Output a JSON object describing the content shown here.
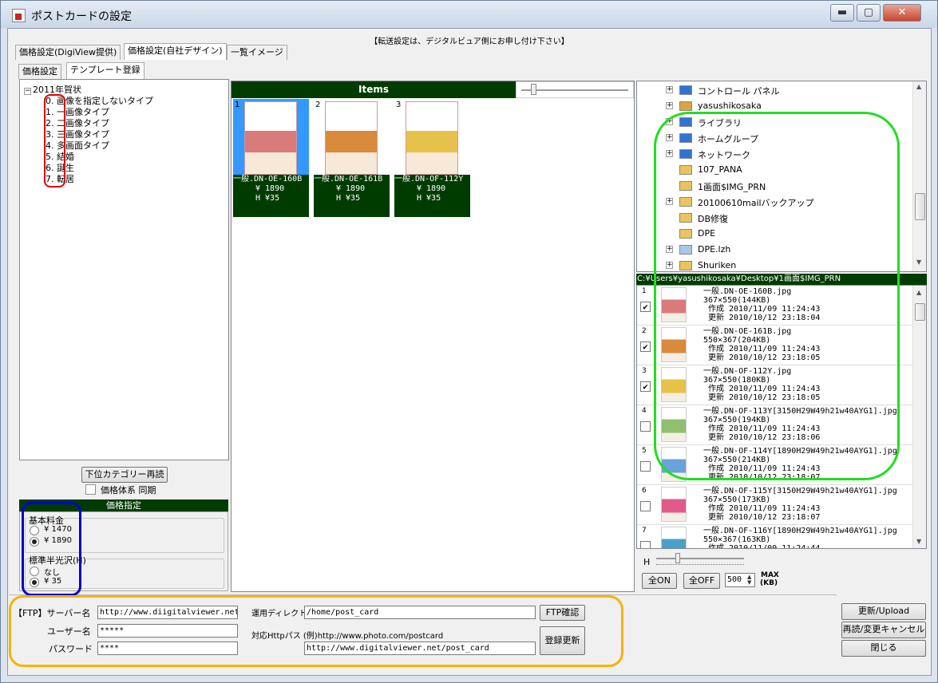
{
  "window": {
    "title": "ポストカードの設定",
    "minimize_glyph": "▬",
    "maximize_glyph": "▢",
    "close_glyph": "✕"
  },
  "notice": "【転送設定は、デジタルビュア側にお申し付け下さい】",
  "tabs": [
    {
      "label": "価格設定(DigiView提供)",
      "active": false
    },
    {
      "label": "価格設定(自社デザイン)",
      "active": true
    },
    {
      "label": "一覧イメージ",
      "active": false
    }
  ],
  "subtabs": [
    {
      "label": "価格設定",
      "active": false
    },
    {
      "label": "テンプレート登録",
      "active": true
    }
  ],
  "tree": {
    "root": "2011年賀状",
    "items": [
      {
        "num": "0.",
        "label": "画像を指定しないタイプ"
      },
      {
        "num": "1.",
        "label": "一画像タイプ"
      },
      {
        "num": "2.",
        "label": "二画像タイプ"
      },
      {
        "num": "3.",
        "label": "三画像タイプ"
      },
      {
        "num": "4.",
        "label": "多画面タイプ"
      },
      {
        "num": "5.",
        "label": "結婚"
      },
      {
        "num": "6.",
        "label": "誕生"
      },
      {
        "num": "7.",
        "label": "転居"
      }
    ]
  },
  "left_controls": {
    "reload_button": "下位カテゴリー再読",
    "sync_checkbox": "価格体系 同期",
    "price_header": "価格指定",
    "base_price_label": "基本料金",
    "base_options": [
      "¥ 1470",
      "¥ 1890"
    ],
    "base_selected": 1,
    "gloss_label": "標準半光沢(H)",
    "gloss_options": [
      "なし",
      "¥ 35"
    ],
    "gloss_selected": 1
  },
  "items_panel": {
    "header": "Items",
    "cards": [
      {
        "num": "1",
        "name": "一般.DN-OE-160B",
        "price": "¥ 1890",
        "extra": "H ¥35",
        "selected": true,
        "color": "#d97b7b"
      },
      {
        "num": "2",
        "name": "一般.DN-OE-161B",
        "price": "¥ 1890",
        "extra": "H ¥35",
        "selected": false,
        "color": "#d98a3a"
      },
      {
        "num": "3",
        "name": "一般.DN-OF-112Y",
        "price": "¥ 1890",
        "extra": "H ¥35",
        "selected": false,
        "color": "#e6c24a"
      }
    ]
  },
  "folders": [
    {
      "label": "コントロール パネル",
      "expander": true,
      "icon": "blue"
    },
    {
      "label": "yasushikosaka",
      "expander": true,
      "icon": "user"
    },
    {
      "label": "ライブラリ",
      "expander": true,
      "icon": "blue"
    },
    {
      "label": "ホームグループ",
      "expander": true,
      "icon": "blue"
    },
    {
      "label": "ネットワーク",
      "expander": true,
      "icon": "blue"
    },
    {
      "label": "107_PANA",
      "expander": false,
      "icon": "yellow"
    },
    {
      "label": "1画面$IMG_PRN",
      "expander": false,
      "icon": "yellow"
    },
    {
      "label": "20100610mailバックアップ",
      "expander": true,
      "icon": "yellow"
    },
    {
      "label": "DB修復",
      "expander": false,
      "icon": "yellow"
    },
    {
      "label": "DPE",
      "expander": false,
      "icon": "yellow"
    },
    {
      "label": "DPE.lzh",
      "expander": true,
      "icon": "zip"
    },
    {
      "label": "Shuriken",
      "expander": true,
      "icon": "yellow"
    }
  ],
  "path_bar": "C:¥Users¥yasushikosaka¥Desktop¥1画面$IMG_PRN",
  "files": [
    {
      "num": "1",
      "checked": true,
      "name": "一般.DN-OE-160B.jpg",
      "dims": "367×550(144KB)",
      "created": "作成 2010/11/09 11:24:43",
      "updated": "更新 2010/10/12 23:18:04",
      "color": "#d97b7b"
    },
    {
      "num": "2",
      "checked": true,
      "name": "一般.DN-OE-161B.jpg",
      "dims": "550×367(204KB)",
      "created": "作成 2010/11/09 11:24:43",
      "updated": "更新 2010/10/12 23:18:05",
      "color": "#d98a3a"
    },
    {
      "num": "3",
      "checked": true,
      "name": "一般.DN-OF-112Y.jpg",
      "dims": "367×550(180KB)",
      "created": "作成 2010/11/09 11:24:43",
      "updated": "更新 2010/10/12 23:18:05",
      "color": "#e6c24a"
    },
    {
      "num": "4",
      "checked": false,
      "name": "一般.DN-OF-113Y[3150H29W49h21w40AYG1].jpg",
      "dims": "367×550(194KB)",
      "created": "作成 2010/11/09 11:24:43",
      "updated": "更新 2010/10/12 23:18:06",
      "color": "#8fbf6f"
    },
    {
      "num": "5",
      "checked": false,
      "name": "一般.DN-OF-114Y[1890H29W49h21w40AYG1].jpg",
      "dims": "367×550(214KB)",
      "created": "作成 2010/11/09 11:24:43",
      "updated": "更新 2010/10/12 23:18:07",
      "color": "#6aa2d9"
    },
    {
      "num": "6",
      "checked": false,
      "name": "一般.DN-OF-115Y[3150H29W49h21w40AYG1].jpg",
      "dims": "367×550(173KB)",
      "created": "作成 2010/11/09 11:24:43",
      "updated": "更新 2010/10/12 23:18:07",
      "color": "#e05a8a"
    },
    {
      "num": "7",
      "checked": false,
      "name": "一般.DN-OF-116Y[1890H29W49h21w40AYG1].jpg",
      "dims": "550×367(163KB)",
      "created": "作成 2010/11/09 11:24:44",
      "updated": "",
      "color": "#4aa0c8"
    }
  ],
  "file_controls": {
    "h_label": "H",
    "all_on": "全ON",
    "all_off": "全OFF",
    "max_value": "500",
    "max_label": "MAX",
    "max_unit": "(KB)"
  },
  "ftp": {
    "server_label": "【FTP】サーバー名",
    "server_value": "http://www.diigitalviewer.net",
    "user_label": "ユーザー名",
    "user_value": "*****",
    "password_label": "パスワード",
    "password_value": "****",
    "dir_label": "運用ディレクトリ",
    "dir_value": "/home/post_card",
    "http_label": "対応Httpパス (例)http://www.photo.com/postcard",
    "http_value": "http://www.digitalviewer.net/post_card",
    "ftp_check_button": "FTP確認",
    "register_button": "登録更新"
  },
  "actions": {
    "update_upload": "更新/Upload",
    "reload_cancel": "再読/変更キャンセル",
    "close": "閉じる"
  },
  "colors": {
    "green_header": "#003c00",
    "selection_blue": "#3399ff",
    "annotation_red": "#e00000",
    "annotation_blue": "#0000d0",
    "annotation_green": "#22dd22",
    "annotation_orange": "#f5b400"
  }
}
